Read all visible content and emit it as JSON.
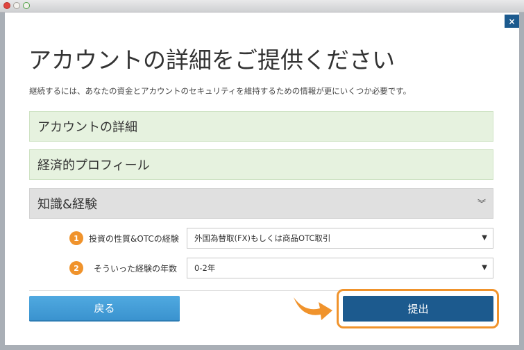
{
  "dialog": {
    "title": "アカウントの詳細をご提供ください",
    "subtitle": "継続するには、あなたの資金とアカウントのセキュリティを維持するための情報が更にいくつか必要です。",
    "close_label": "×"
  },
  "sections": [
    {
      "label": "アカウントの詳細",
      "state": "completed"
    },
    {
      "label": "経済的プロフィール",
      "state": "completed"
    },
    {
      "label": "知識&経験",
      "state": "expanded",
      "toggle_icon": "double-chevron-down-icon"
    }
  ],
  "form": {
    "rows": [
      {
        "step": "1",
        "label": "投資の性質&OTCの経験",
        "value": "外国為替取(FX)もしくは商品OTC取引"
      },
      {
        "step": "2",
        "label": "そういった経験の年数",
        "value": "0-2年"
      }
    ]
  },
  "buttons": {
    "back": "戻る",
    "submit": "提出"
  },
  "colors": {
    "accent": "#1c5a8e",
    "back_button": "#3d9ad6",
    "highlight": "#f0932c",
    "completed_section": "#e6f2df",
    "active_section": "#e0e0e0"
  }
}
